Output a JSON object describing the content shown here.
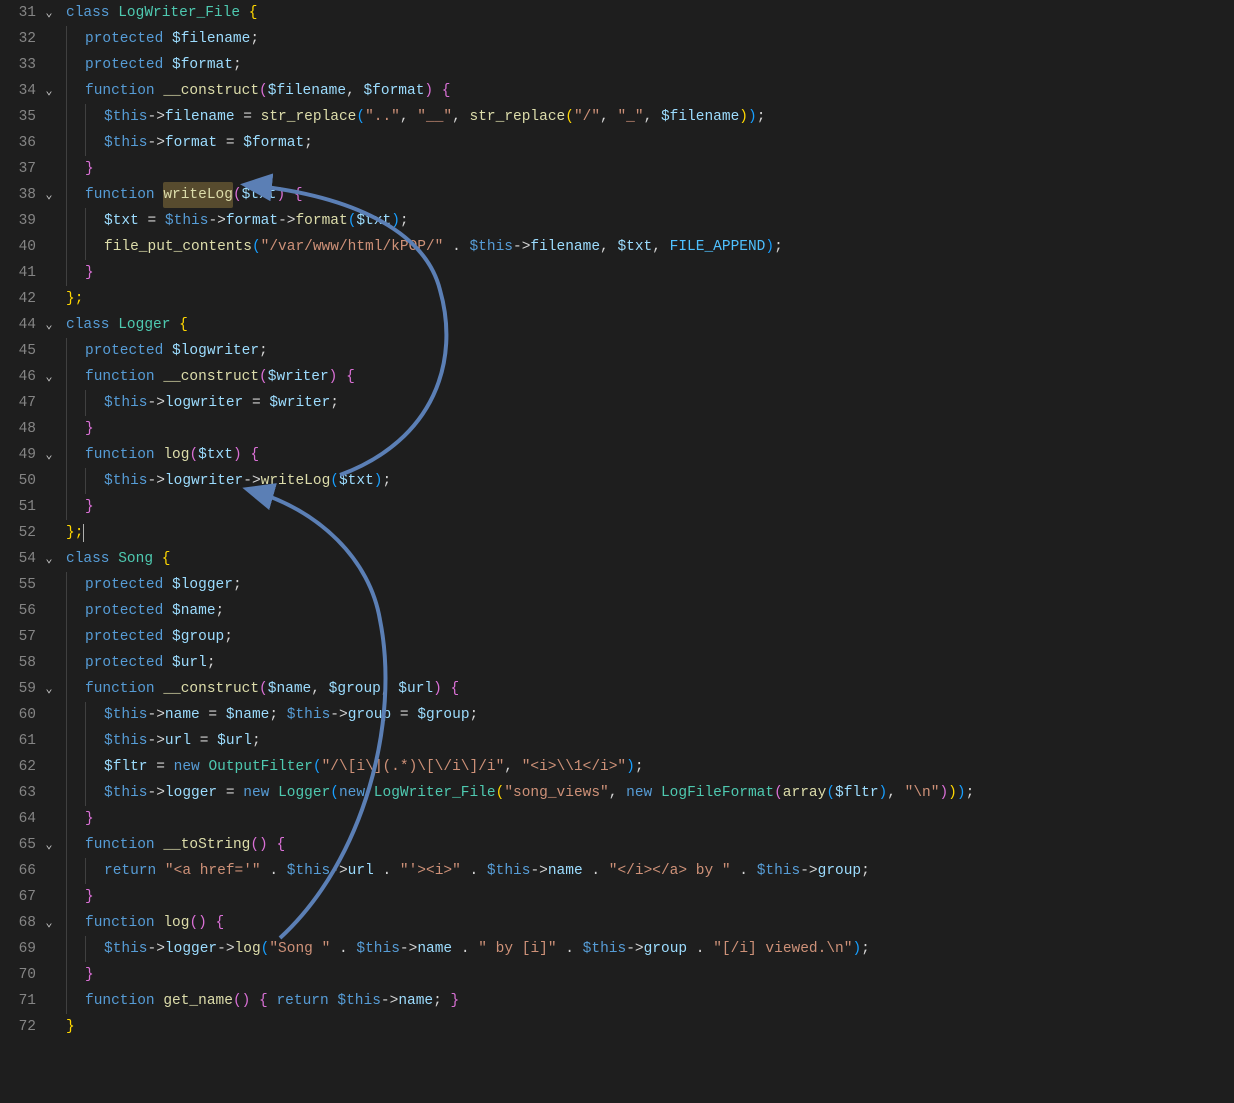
{
  "colors": {
    "background": "#1e1e1e",
    "foreground": "#d4d4d4",
    "gutter": "#858585",
    "keyword": "#569cd6",
    "class": "#4ec9b0",
    "function": "#dcdcaa",
    "variable": "#9cdcfe",
    "string": "#ce9178",
    "bracketYellow": "#ffd700",
    "bracketPink": "#da70d6",
    "bracketBlue": "#179fff",
    "constant": "#4fc1ff",
    "arrow": "#5b7fb5",
    "highlight": "#574b2e"
  },
  "highlighted_identifier": "writeLog",
  "annotations": [
    {
      "type": "arrow",
      "from_line": 69,
      "to_line": 50,
      "note": "Song.log calls Logger.log"
    },
    {
      "type": "arrow",
      "from_line": 50,
      "to_line": 38,
      "note": "Logger.log calls LogWriter_File.writeLog"
    }
  ],
  "lines": [
    {
      "n": 31,
      "fold": true,
      "i": 0,
      "tokens": [
        [
          "class ",
          "kw"
        ],
        [
          "LogWriter_File",
          "cls"
        ],
        [
          " {",
          "brkR"
        ]
      ]
    },
    {
      "n": 32,
      "i": 1,
      "tokens": [
        [
          "protected ",
          "kw"
        ],
        [
          "$filename",
          "var"
        ],
        [
          ";",
          "punc"
        ]
      ]
    },
    {
      "n": 33,
      "i": 1,
      "tokens": [
        [
          "protected ",
          "kw"
        ],
        [
          "$format",
          "var"
        ],
        [
          ";",
          "punc"
        ]
      ]
    },
    {
      "n": 34,
      "fold": true,
      "i": 1,
      "tokens": [
        [
          "function ",
          "kw"
        ],
        [
          "__construct",
          "fn"
        ],
        [
          "(",
          "brkP"
        ],
        [
          "$filename",
          "var"
        ],
        [
          ", ",
          "punc"
        ],
        [
          "$format",
          "var"
        ],
        [
          ")",
          "brkP"
        ],
        [
          " {",
          "brkP"
        ]
      ]
    },
    {
      "n": 35,
      "i": 2,
      "tokens": [
        [
          "$this",
          "kw"
        ],
        [
          "->",
          "op"
        ],
        [
          "filename",
          "mem"
        ],
        [
          " = ",
          "op"
        ],
        [
          "str_replace",
          "fn"
        ],
        [
          "(",
          "brkB"
        ],
        [
          "\"..\"",
          "str"
        ],
        [
          ", ",
          "punc"
        ],
        [
          "\"__\"",
          "str"
        ],
        [
          ", ",
          "punc"
        ],
        [
          "str_replace",
          "fn"
        ],
        [
          "(",
          "brkR"
        ],
        [
          "\"/\"",
          "str"
        ],
        [
          ", ",
          "punc"
        ],
        [
          "\"_\"",
          "str"
        ],
        [
          ", ",
          "punc"
        ],
        [
          "$filename",
          "var"
        ],
        [
          ")",
          "brkR"
        ],
        [
          ")",
          "brkB"
        ],
        [
          ";",
          "punc"
        ]
      ]
    },
    {
      "n": 36,
      "i": 2,
      "tokens": [
        [
          "$this",
          "kw"
        ],
        [
          "->",
          "op"
        ],
        [
          "format",
          "mem"
        ],
        [
          " = ",
          "op"
        ],
        [
          "$format",
          "var"
        ],
        [
          ";",
          "punc"
        ]
      ]
    },
    {
      "n": 37,
      "i": 1,
      "tokens": [
        [
          "}",
          "brkP"
        ]
      ]
    },
    {
      "n": 38,
      "fold": true,
      "i": 1,
      "tokens": [
        [
          "function ",
          "kw"
        ],
        [
          "writeLog",
          "fn hl"
        ],
        [
          "(",
          "brkP"
        ],
        [
          "$txt",
          "var"
        ],
        [
          ")",
          "brkP"
        ],
        [
          " {",
          "brkP"
        ]
      ]
    },
    {
      "n": 39,
      "i": 2,
      "tokens": [
        [
          "$txt",
          "var"
        ],
        [
          " = ",
          "op"
        ],
        [
          "$this",
          "kw"
        ],
        [
          "->",
          "op"
        ],
        [
          "format",
          "mem"
        ],
        [
          "->",
          "op"
        ],
        [
          "format",
          "fn"
        ],
        [
          "(",
          "brkB"
        ],
        [
          "$txt",
          "var"
        ],
        [
          ")",
          "brkB"
        ],
        [
          ";",
          "punc"
        ]
      ]
    },
    {
      "n": 40,
      "i": 2,
      "tokens": [
        [
          "file_put_contents",
          "fn"
        ],
        [
          "(",
          "brkB"
        ],
        [
          "\"/var/www/html/kPOP/\"",
          "str"
        ],
        [
          " . ",
          "op"
        ],
        [
          "$this",
          "kw"
        ],
        [
          "->",
          "op"
        ],
        [
          "filename",
          "mem"
        ],
        [
          ", ",
          "punc"
        ],
        [
          "$txt",
          "var"
        ],
        [
          ", ",
          "punc"
        ],
        [
          "FILE_APPEND",
          "const"
        ],
        [
          ")",
          "brkB"
        ],
        [
          ";",
          "punc"
        ]
      ]
    },
    {
      "n": 41,
      "i": 1,
      "tokens": [
        [
          "}",
          "brkP"
        ]
      ]
    },
    {
      "n": 42,
      "i": 0,
      "tokens": [
        [
          "};",
          "brkR"
        ]
      ]
    },
    {
      "n": 44,
      "fold": true,
      "i": 0,
      "tokens": [
        [
          "class ",
          "kw"
        ],
        [
          "Logger",
          "cls"
        ],
        [
          " {",
          "brkR"
        ]
      ]
    },
    {
      "n": 45,
      "i": 1,
      "tokens": [
        [
          "protected ",
          "kw"
        ],
        [
          "$logwriter",
          "var"
        ],
        [
          ";",
          "punc"
        ]
      ]
    },
    {
      "n": 46,
      "fold": true,
      "i": 1,
      "tokens": [
        [
          "function ",
          "kw"
        ],
        [
          "__construct",
          "fn"
        ],
        [
          "(",
          "brkP"
        ],
        [
          "$writer",
          "var"
        ],
        [
          ")",
          "brkP"
        ],
        [
          " {",
          "brkP"
        ]
      ]
    },
    {
      "n": 47,
      "i": 2,
      "tokens": [
        [
          "$this",
          "kw"
        ],
        [
          "->",
          "op"
        ],
        [
          "logwriter",
          "mem"
        ],
        [
          " = ",
          "op"
        ],
        [
          "$writer",
          "var"
        ],
        [
          ";",
          "punc"
        ]
      ]
    },
    {
      "n": 48,
      "i": 1,
      "tokens": [
        [
          "}",
          "brkP"
        ]
      ]
    },
    {
      "n": 49,
      "fold": true,
      "i": 1,
      "tokens": [
        [
          "function ",
          "kw"
        ],
        [
          "log",
          "fn"
        ],
        [
          "(",
          "brkP"
        ],
        [
          "$txt",
          "var"
        ],
        [
          ")",
          "brkP"
        ],
        [
          " {",
          "brkP"
        ]
      ]
    },
    {
      "n": 50,
      "i": 2,
      "tokens": [
        [
          "$this",
          "kw"
        ],
        [
          "->",
          "op"
        ],
        [
          "logwriter",
          "mem"
        ],
        [
          "->",
          "op"
        ],
        [
          "writeLog",
          "fn"
        ],
        [
          "(",
          "brkB"
        ],
        [
          "$txt",
          "var"
        ],
        [
          ")",
          "brkB"
        ],
        [
          ";",
          "punc"
        ]
      ]
    },
    {
      "n": 51,
      "i": 1,
      "tokens": [
        [
          "}",
          "brkP"
        ]
      ]
    },
    {
      "n": 52,
      "i": 0,
      "tokens": [
        [
          "};",
          "brkR"
        ],
        [
          "|",
          "cursor"
        ]
      ]
    },
    {
      "n": 54,
      "fold": true,
      "i": 0,
      "tokens": [
        [
          "class ",
          "kw"
        ],
        [
          "Song",
          "cls"
        ],
        [
          " {",
          "brkR"
        ]
      ]
    },
    {
      "n": 55,
      "i": 1,
      "tokens": [
        [
          "protected ",
          "kw"
        ],
        [
          "$logger",
          "var"
        ],
        [
          ";",
          "punc"
        ]
      ]
    },
    {
      "n": 56,
      "i": 1,
      "tokens": [
        [
          "protected ",
          "kw"
        ],
        [
          "$name",
          "var"
        ],
        [
          ";",
          "punc"
        ]
      ]
    },
    {
      "n": 57,
      "i": 1,
      "tokens": [
        [
          "protected ",
          "kw"
        ],
        [
          "$group",
          "var"
        ],
        [
          ";",
          "punc"
        ]
      ]
    },
    {
      "n": 58,
      "i": 1,
      "tokens": [
        [
          "protected ",
          "kw"
        ],
        [
          "$url",
          "var"
        ],
        [
          ";",
          "punc"
        ]
      ]
    },
    {
      "n": 59,
      "fold": true,
      "i": 1,
      "tokens": [
        [
          "function ",
          "kw"
        ],
        [
          "__construct",
          "fn"
        ],
        [
          "(",
          "brkP"
        ],
        [
          "$name",
          "var"
        ],
        [
          ", ",
          "punc"
        ],
        [
          "$group",
          "var"
        ],
        [
          ", ",
          "punc"
        ],
        [
          "$url",
          "var"
        ],
        [
          ")",
          "brkP"
        ],
        [
          " {",
          "brkP"
        ]
      ]
    },
    {
      "n": 60,
      "i": 2,
      "tokens": [
        [
          "$this",
          "kw"
        ],
        [
          "->",
          "op"
        ],
        [
          "name",
          "mem"
        ],
        [
          " = ",
          "op"
        ],
        [
          "$name",
          "var"
        ],
        [
          "; ",
          "punc"
        ],
        [
          "$this",
          "kw"
        ],
        [
          "->",
          "op"
        ],
        [
          "group",
          "mem"
        ],
        [
          " = ",
          "op"
        ],
        [
          "$group",
          "var"
        ],
        [
          ";",
          "punc"
        ]
      ]
    },
    {
      "n": 61,
      "i": 2,
      "tokens": [
        [
          "$this",
          "kw"
        ],
        [
          "->",
          "op"
        ],
        [
          "url",
          "mem"
        ],
        [
          " = ",
          "op"
        ],
        [
          "$url",
          "var"
        ],
        [
          ";",
          "punc"
        ]
      ]
    },
    {
      "n": 62,
      "i": 2,
      "tokens": [
        [
          "$fltr",
          "var"
        ],
        [
          " = ",
          "op"
        ],
        [
          "new ",
          "kw"
        ],
        [
          "OutputFilter",
          "cls"
        ],
        [
          "(",
          "brkB"
        ],
        [
          "\"/\\[i\\](.*)\\[\\/i\\]/i\"",
          "str"
        ],
        [
          ", ",
          "punc"
        ],
        [
          "\"<i>\\\\1</i>\"",
          "str"
        ],
        [
          ")",
          "brkB"
        ],
        [
          ";",
          "punc"
        ]
      ]
    },
    {
      "n": 63,
      "i": 2,
      "tokens": [
        [
          "$this",
          "kw"
        ],
        [
          "->",
          "op"
        ],
        [
          "logger",
          "mem"
        ],
        [
          " = ",
          "op"
        ],
        [
          "new ",
          "kw"
        ],
        [
          "Logger",
          "cls"
        ],
        [
          "(",
          "brkB"
        ],
        [
          "new ",
          "kw"
        ],
        [
          "LogWriter_File",
          "cls"
        ],
        [
          "(",
          "brkR"
        ],
        [
          "\"song_views\"",
          "str"
        ],
        [
          ", ",
          "punc"
        ],
        [
          "new ",
          "kw"
        ],
        [
          "LogFileFormat",
          "cls"
        ],
        [
          "(",
          "brkP"
        ],
        [
          "array",
          "fn"
        ],
        [
          "(",
          "brkB"
        ],
        [
          "$fltr",
          "var"
        ],
        [
          ")",
          "brkB"
        ],
        [
          ", ",
          "punc"
        ],
        [
          "\"\\n\"",
          "str"
        ],
        [
          ")",
          "brkP"
        ],
        [
          ")",
          "brkR"
        ],
        [
          ")",
          "brkB"
        ],
        [
          ";",
          "punc"
        ]
      ]
    },
    {
      "n": 64,
      "i": 1,
      "tokens": [
        [
          "}",
          "brkP"
        ]
      ]
    },
    {
      "n": 65,
      "fold": true,
      "i": 1,
      "tokens": [
        [
          "function ",
          "kw"
        ],
        [
          "__toString",
          "fn"
        ],
        [
          "(",
          "brkP"
        ],
        [
          ")",
          "brkP"
        ],
        [
          " {",
          "brkP"
        ]
      ]
    },
    {
      "n": 66,
      "i": 2,
      "tokens": [
        [
          "return ",
          "kw"
        ],
        [
          "\"<a href='\"",
          "str"
        ],
        [
          " . ",
          "op"
        ],
        [
          "$this",
          "kw"
        ],
        [
          "->",
          "op"
        ],
        [
          "url",
          "mem"
        ],
        [
          " . ",
          "op"
        ],
        [
          "\"'><i>\"",
          "str"
        ],
        [
          " . ",
          "op"
        ],
        [
          "$this",
          "kw"
        ],
        [
          "->",
          "op"
        ],
        [
          "name",
          "mem"
        ],
        [
          " . ",
          "op"
        ],
        [
          "\"</i></a> by \"",
          "str"
        ],
        [
          " . ",
          "op"
        ],
        [
          "$this",
          "kw"
        ],
        [
          "->",
          "op"
        ],
        [
          "group",
          "mem"
        ],
        [
          ";",
          "punc"
        ]
      ]
    },
    {
      "n": 67,
      "i": 1,
      "tokens": [
        [
          "}",
          "brkP"
        ]
      ]
    },
    {
      "n": 68,
      "fold": true,
      "i": 1,
      "tokens": [
        [
          "function ",
          "kw"
        ],
        [
          "log",
          "fn"
        ],
        [
          "(",
          "brkP"
        ],
        [
          ")",
          "brkP"
        ],
        [
          " {",
          "brkP"
        ]
      ]
    },
    {
      "n": 69,
      "i": 2,
      "tokens": [
        [
          "$this",
          "kw"
        ],
        [
          "->",
          "op"
        ],
        [
          "logger",
          "mem"
        ],
        [
          "->",
          "op"
        ],
        [
          "log",
          "fn"
        ],
        [
          "(",
          "brkB"
        ],
        [
          "\"Song \"",
          "str"
        ],
        [
          " . ",
          "op"
        ],
        [
          "$this",
          "kw"
        ],
        [
          "->",
          "op"
        ],
        [
          "name",
          "mem"
        ],
        [
          " . ",
          "op"
        ],
        [
          "\" by [i]\"",
          "str"
        ],
        [
          " . ",
          "op"
        ],
        [
          "$this",
          "kw"
        ],
        [
          "->",
          "op"
        ],
        [
          "group",
          "mem"
        ],
        [
          " . ",
          "op"
        ],
        [
          "\"[/i] viewed.\\n\"",
          "str"
        ],
        [
          ")",
          "brkB"
        ],
        [
          ";",
          "punc"
        ]
      ]
    },
    {
      "n": 70,
      "i": 1,
      "tokens": [
        [
          "}",
          "brkP"
        ]
      ]
    },
    {
      "n": 71,
      "i": 1,
      "tokens": [
        [
          "function ",
          "kw"
        ],
        [
          "get_name",
          "fn"
        ],
        [
          "(",
          "brkP"
        ],
        [
          ")",
          "brkP"
        ],
        [
          " { ",
          "brkP"
        ],
        [
          "return ",
          "kw"
        ],
        [
          "$this",
          "kw"
        ],
        [
          "->",
          "op"
        ],
        [
          "name",
          "mem"
        ],
        [
          "; ",
          "punc"
        ],
        [
          "}",
          "brkP"
        ]
      ]
    },
    {
      "n": 72,
      "i": 0,
      "tokens": [
        [
          "}",
          "brkR"
        ]
      ]
    }
  ]
}
